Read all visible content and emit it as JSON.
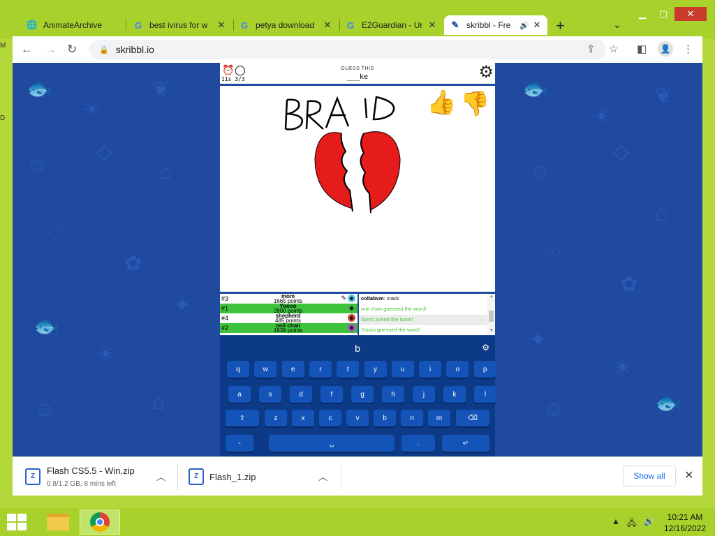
{
  "browser": {
    "tabs": [
      {
        "title": "AnimateArchive",
        "icon": "globe-icon",
        "active": false
      },
      {
        "title": "best ivirus for w",
        "icon": "google-icon",
        "active": false
      },
      {
        "title": "petya download",
        "icon": "google-icon",
        "active": false
      },
      {
        "title": "E2Guardian - Ur",
        "icon": "google-icon",
        "active": false
      },
      {
        "title": "skribbl - Fre",
        "icon": "skribbl-icon",
        "active": true
      }
    ],
    "new_tab_label": "+",
    "url": "skribbl.io"
  },
  "game": {
    "timer": "11s",
    "round": "3/3",
    "guess_label": "GUESS THIS",
    "word_hint": "___ke",
    "canvas_text": "BRA D",
    "players": [
      {
        "rank": "#3",
        "name": "mom",
        "points": "1665 points",
        "highlight": false,
        "drawing": true
      },
      {
        "rank": "#1",
        "name": "Yoooo",
        "points": "2800 points",
        "highlight": true,
        "drawing": false
      },
      {
        "rank": "#4",
        "name": "shepherd",
        "points": "485 points",
        "highlight": false,
        "drawing": false
      },
      {
        "rank": "#2",
        "name": "onii chan",
        "points": "1939 points",
        "highlight": true,
        "drawing": false
      }
    ],
    "chat": [
      {
        "sender": "collabvm",
        "text": ": crack",
        "style": "normal"
      },
      {
        "sender": "",
        "text": "onii chan guessed the word!",
        "style": "green"
      },
      {
        "sender": "",
        "text": "Sonic joined the room!",
        "style": "green-alt"
      },
      {
        "sender": "",
        "text": "Yoooo guessed the word!",
        "style": "green"
      }
    ]
  },
  "keyboard": {
    "typed": "b",
    "row1": [
      "q",
      "w",
      "e",
      "r",
      "t",
      "y",
      "u",
      "i",
      "o",
      "p"
    ],
    "row2": [
      "a",
      "s",
      "d",
      "f",
      "g",
      "h",
      "j",
      "k",
      "l"
    ],
    "row3": [
      "⇧",
      "z",
      "x",
      "c",
      "v",
      "b",
      "n",
      "m",
      "⌫"
    ],
    "row4": [
      "-",
      "␣",
      ".",
      "↵"
    ]
  },
  "downloads": [
    {
      "name": "Flash CS5.5 - Win.zip",
      "status": "0.8/1.2 GB, 8 mins left"
    },
    {
      "name": "Flash_1.zip",
      "status": ""
    }
  ],
  "download_bar": {
    "show_all": "Show all"
  },
  "taskbar": {
    "time": "10:21 AM",
    "date": "12/16/2022"
  },
  "desktop": {
    "left_labels": [
      "M",
      "D"
    ]
  },
  "colors": {
    "accent": "#a8d12c",
    "page_bg": "#1f4aa0",
    "green_row": "#3ec43c",
    "keyboard_bg": "#0c3a86"
  }
}
